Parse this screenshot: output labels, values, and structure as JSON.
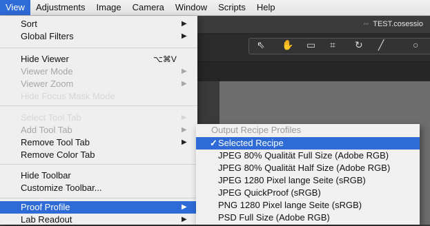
{
  "menubar": {
    "items": [
      "View",
      "Adjustments",
      "Image",
      "Camera",
      "Window",
      "Scripts",
      "Help"
    ],
    "active": "View"
  },
  "app": {
    "title": "TEST.cosessio",
    "toolbar_icons": [
      "cursor-select-icon",
      "hand-pan-icon",
      "crop-overlay-icon",
      "crop-icon",
      "rotate-icon",
      "straighten-icon",
      "circle-icon"
    ]
  },
  "view_menu": {
    "items": [
      {
        "label": "Sort",
        "submenu": true
      },
      {
        "label": "Global Filters",
        "submenu": true
      },
      {
        "label": "Hide Viewer",
        "shortcut": "⌥⌘V"
      },
      {
        "label": "Viewer Mode",
        "submenu": true,
        "disabled": true
      },
      {
        "label": "Viewer Zoom",
        "submenu": true,
        "disabled": true
      },
      {
        "label": "Hide Focus Mask Mode"
      },
      {
        "label": "Select Tool Tab",
        "submenu": true
      },
      {
        "label": "Add Tool Tab",
        "submenu": true
      },
      {
        "label": "Remove Tool Tab",
        "submenu": true
      },
      {
        "label": "Remove Color Tab"
      },
      {
        "label": "Hide Toolbar"
      },
      {
        "label": "Customize Toolbar..."
      },
      {
        "label": "Proof Profile",
        "submenu": true,
        "highlighted": true
      },
      {
        "label": "Lab Readout",
        "submenu": true
      }
    ]
  },
  "proof_submenu": {
    "header": "Output Recipe Profiles",
    "checkmark": "✓",
    "items": [
      {
        "label": "Selected Recipe",
        "checked": true
      },
      {
        "label": "JPEG 80% Qualität Full Size (Adobe RGB)"
      },
      {
        "label": "JPEG 80% Qualität Half Size (Adobe RGB)"
      },
      {
        "label": "JPEG 1280 Pixel lange Seite (sRGB)"
      },
      {
        "label": "JPEG QuickProof (sRGB)"
      },
      {
        "label": "PNG 1280 Pixel lange Seite (sRGB)"
      },
      {
        "label": "PSD Full Size (Adobe RGB)"
      }
    ]
  }
}
